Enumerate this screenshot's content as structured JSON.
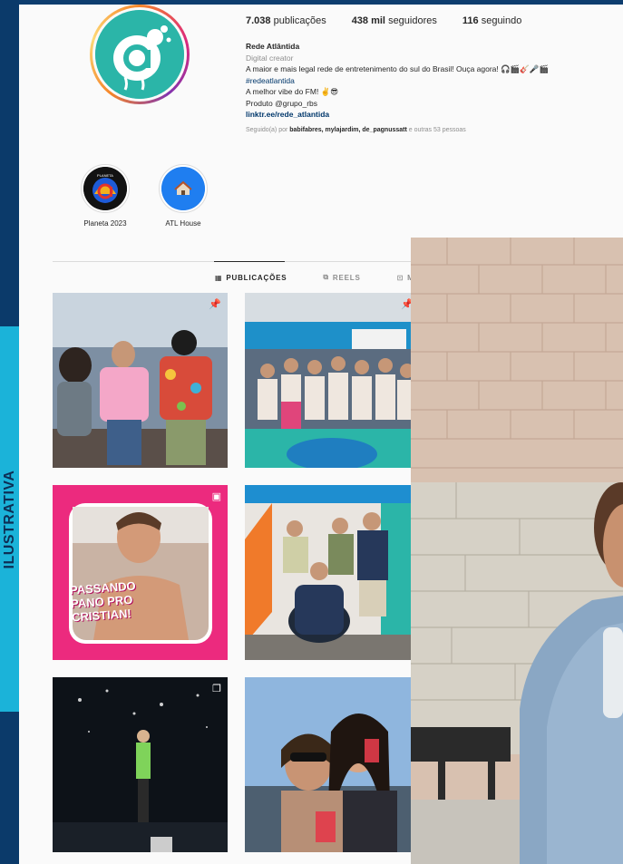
{
  "side_label": "ILUSTRATIVA",
  "profile": {
    "stats": {
      "posts_value": "7.038",
      "posts_label": "publicações",
      "followers_value": "438 mil",
      "followers_label": "seguidores",
      "following_value": "116",
      "following_label": "seguindo"
    },
    "name": "Rede Atlântida",
    "category": "Digital creator",
    "bio_line1": "A maior e mais legal rede de entretenimento do sul do Brasil! Ouça agora! 🎧🎬🎸🎤🎬",
    "hashtag": "#redeatlantida",
    "bio_line2": "A melhor vibe do FM! ✌️😎",
    "bio_line3": "Produto @grupo_rbs",
    "link": "linktr.ee/rede_atlantida",
    "followed_by_prefix": "Seguido(a) por",
    "followed_by_names": "babifabres, mylajardim, de_pagnussatt",
    "followed_by_suffix": "e outras 53 pessoas"
  },
  "highlights": [
    {
      "label": "Planeta 2023",
      "icon": "planeta-atlantida-logo"
    },
    {
      "label": "ATL House",
      "icon": "house-icon"
    }
  ],
  "tabs": [
    {
      "label": "PUBLICAÇÕES",
      "icon": "grid-icon",
      "active": true
    },
    {
      "label": "REELS",
      "icon": "reels-icon",
      "active": false
    },
    {
      "label": "M",
      "icon": "tagged-icon",
      "active": false
    }
  ],
  "posts": [
    {
      "icon": "pin-icon"
    },
    {
      "icon": "pin-icon"
    },
    {
      "icon": "reels-icon",
      "text_line1": "PASSANDO",
      "text_line2": "PANO PRO",
      "text_line3": "CRISTIAN!"
    },
    {
      "icon": ""
    },
    {
      "icon": "carousel-icon"
    },
    {
      "icon": ""
    }
  ],
  "colors": {
    "ig_background": "#fafafa",
    "brand_teal": "#2bb5a8",
    "side_accent": "#1bb3d9",
    "frame_blue": "#0b3a6a",
    "reel_pink": "#ec2a7e"
  }
}
